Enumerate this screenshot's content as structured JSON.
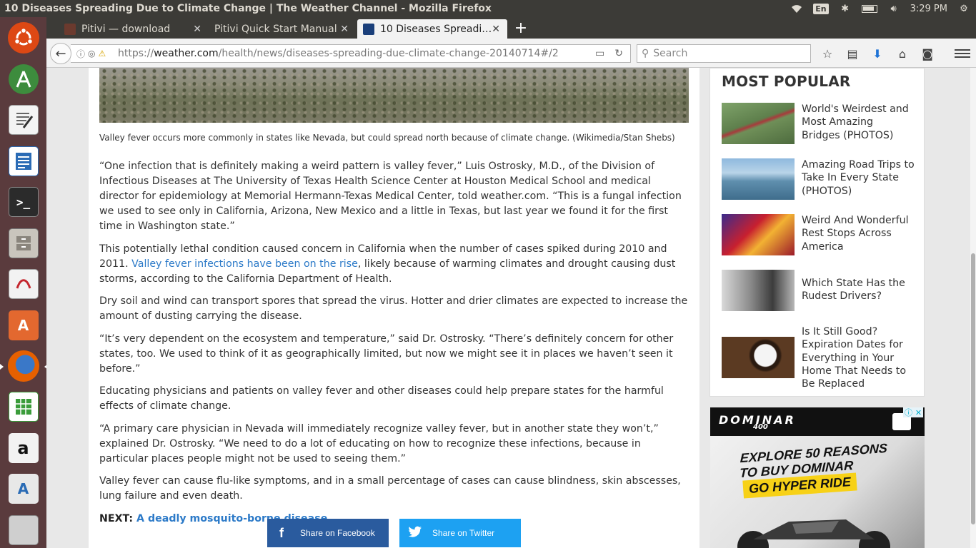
{
  "system": {
    "window_title": "10 Diseases Spreading Due to Climate Change | The Weather Channel - Mozilla Firefox",
    "lang": "En",
    "time": "3:29 PM"
  },
  "launcher": {
    "items": [
      "ubuntu-dash",
      "android-studio",
      "text-editor",
      "libreoffice-writer",
      "terminal",
      "files",
      "pdf-viewer",
      "software-center",
      "firefox",
      "libreoffice-calc",
      "amazon",
      "software-updater",
      "stacked-windows"
    ]
  },
  "tabs": [
    {
      "label": "Pitivi — download",
      "active": false
    },
    {
      "label": "Pitivi Quick Start Manual",
      "active": false
    },
    {
      "label": "10 Diseases Spreadi…",
      "active": true
    }
  ],
  "nav": {
    "url_prefix": "https://",
    "url_domain": "weather.com",
    "url_path": "/health/news/diseases-spreading-due-climate-change-20140714#/2",
    "search_placeholder": "Search"
  },
  "article": {
    "caption": "Valley fever occurs more commonly in states like Nevada, but could spread north because of climate change. (Wikimedia/Stan Shebs)",
    "p1": "“One infection that is definitely making a weird pattern is valley fever,” Luis Ostrosky, M.D., of the Division of Infectious Diseases at The University of Texas Health Science Center at Houston Medical School and medical director for epidemiology at Memorial Hermann-Texas Medical Center, told weather.com. “This is a fungal infection we used to see only in California, Arizona, New Mexico and a little in Texas, but last year we found it for the first time in Washington state.”",
    "p2_before": "This potentially lethal condition caused concern in California when the number of cases spiked during 2010 and 2011. ",
    "p2_link": "Valley fever infections have been on the rise",
    "p2_after": ", likely because of warming climates and drought causing dust storms, according to the California Department of Health.",
    "p3": "Dry soil and wind can transport spores that spread the virus. Hotter and drier climates are expected to increase the amount of dusting carrying the disease.",
    "p4": "“It’s very dependent on the ecosystem and temperature,” said Dr. Ostrosky. “There’s definitely concern for other states, too. We used to think of it as geographically limited, but now we might see it in places we haven’t seen it before.”",
    "p5": "Educating physicians and patients on valley fever and other diseases could help prepare states for the harmful effects of climate change.",
    "p6": "“A primary care physician in Nevada will immediately recognize valley fever, but in another state they won’t,” explained Dr. Ostrosky. “We need to do a lot of educating on how to recognize these infections, because in particular places people might not be used to seeing them.”",
    "p7": "Valley fever can cause flu-like symptoms, and in a small percentage of cases can cause blindness, skin abscesses, lung failure and even death.",
    "next_label": "NEXT:",
    "next_link": "A deadly mosquito-borne disease",
    "share_facebook": "Share on Facebook",
    "share_twitter": "Share on Twitter"
  },
  "sidebar": {
    "title": "MOST POPULAR",
    "items": [
      {
        "text": "World's Weirdest and Most Amazing Bridges (PHOTOS)"
      },
      {
        "text": "Amazing Road Trips to Take In Every State (PHOTOS)"
      },
      {
        "text": "Weird And Wonderful Rest Stops Across America"
      },
      {
        "text": "Which State Has the Rudest Drivers?"
      },
      {
        "text": "Is It Still Good? Expiration Dates for Everything in Your Home That Needs to Be Replaced"
      }
    ]
  },
  "ad": {
    "brand": "DOMINAR",
    "model": "400",
    "headline_1": "EXPLORE 50 REASONS",
    "headline_2": "TO BUY DOMINAR",
    "cta": "GO HYPER RIDE"
  }
}
